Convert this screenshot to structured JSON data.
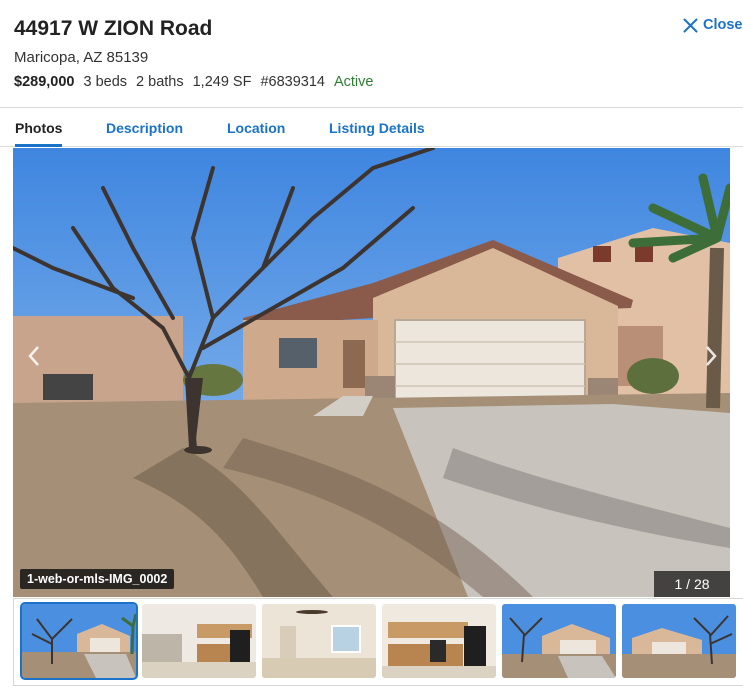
{
  "listing": {
    "street": "44917 W ZION Road",
    "city_line": "Maricopa, AZ 85139",
    "price": "$289,000",
    "beds": "3 beds",
    "baths": "2 baths",
    "sqft": "1,249 SF",
    "mls": "#6839314",
    "status": "Active"
  },
  "close_label": "Close",
  "tabs": [
    {
      "label": "Photos",
      "active": true
    },
    {
      "label": "Description",
      "active": false
    },
    {
      "label": "Location",
      "active": false
    },
    {
      "label": "Listing Details",
      "active": false
    }
  ],
  "gallery": {
    "caption": "1-web-or-mls-IMG_0002",
    "counter": "1 / 28",
    "current": 1,
    "total": 28
  },
  "colors": {
    "accent": "#1a73c8",
    "status_active": "#2e7d32",
    "sky": "#4a8fe0",
    "stucco": "#d9b89a",
    "garage_door": "#ece6dc"
  },
  "thumbnails": [
    {
      "name": "thumb-front-exterior",
      "selected": true
    },
    {
      "name": "thumb-kitchen",
      "selected": false
    },
    {
      "name": "thumb-living-room",
      "selected": false
    },
    {
      "name": "thumb-kitchen-2",
      "selected": false
    },
    {
      "name": "thumb-front-exterior-2",
      "selected": false
    },
    {
      "name": "thumb-front-exterior-3",
      "selected": false
    }
  ]
}
